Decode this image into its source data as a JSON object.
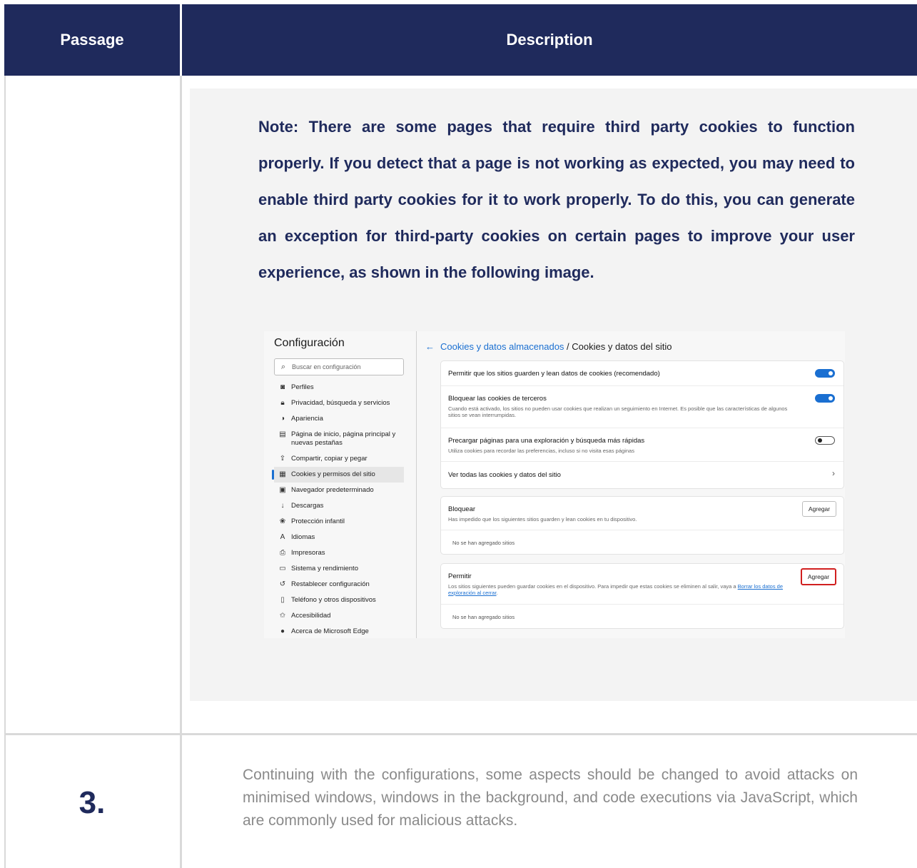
{
  "table": {
    "headers": {
      "passage": "Passage",
      "description": "Description"
    }
  },
  "note": {
    "text": "Note: There are some pages that require third party cookies to function properly. If you detect that a page is not working as expected, you may need to enable third party cookies for it to work properly. To do this, you can generate an exception for third-party cookies on certain pages to improve your user experience, as shown in the following image."
  },
  "settings": {
    "title": "Configuración",
    "search_placeholder": "Buscar en configuración",
    "nav": [
      {
        "icon": "profile-icon",
        "glyph": "◙",
        "label": "Perfiles"
      },
      {
        "icon": "lock-icon",
        "glyph": "🔒︎",
        "label": "Privacidad, búsqueda y servicios"
      },
      {
        "icon": "appearance-icon",
        "glyph": "◑",
        "label": "Apariencia"
      },
      {
        "icon": "homepage-icon",
        "glyph": "▤",
        "label": "Página de inicio, página principal y nuevas pestañas"
      },
      {
        "icon": "share-icon",
        "glyph": "⇪",
        "label": "Compartir, copiar y pegar"
      },
      {
        "icon": "cookies-icon",
        "glyph": "▦",
        "label": "Cookies y permisos del sitio",
        "active": true
      },
      {
        "icon": "browser-icon",
        "glyph": "▣",
        "label": "Navegador predeterminado"
      },
      {
        "icon": "download-icon",
        "glyph": "↓",
        "label": "Descargas"
      },
      {
        "icon": "family-icon",
        "glyph": "❀",
        "label": "Protección infantil"
      },
      {
        "icon": "language-icon",
        "glyph": "A",
        "label": "Idiomas"
      },
      {
        "icon": "printer-icon",
        "glyph": "⎙",
        "label": "Impresoras"
      },
      {
        "icon": "system-icon",
        "glyph": "▭",
        "label": "Sistema y rendimiento"
      },
      {
        "icon": "reset-icon",
        "glyph": "↺",
        "label": "Restablecer configuración"
      },
      {
        "icon": "phone-icon",
        "glyph": "▯",
        "label": "Teléfono y otros dispositivos"
      },
      {
        "icon": "accessibility-icon",
        "glyph": "✩",
        "label": "Accesibilidad"
      },
      {
        "icon": "edge-icon",
        "glyph": "●",
        "label": "Acerca de Microsoft Edge"
      }
    ],
    "breadcrumb": {
      "back": "←",
      "parent": "Cookies y datos almacenados",
      "separator": " / ",
      "current": "Cookies y datos del sitio"
    },
    "options": {
      "allow_cookies": {
        "title": "Permitir que los sitios guarden y lean datos de cookies (recomendado)",
        "on": true
      },
      "block_third_party": {
        "title": "Bloquear las cookies de terceros",
        "sub": "Cuando está activado, los sitios no pueden usar cookies que realizan un seguimiento en Internet. Es posible que las características de algunos sitios se vean interrumpidas.",
        "on": true
      },
      "preload": {
        "title": "Precargar páginas para una exploración y búsqueda más rápidas",
        "sub": "Utiliza cookies para recordar las preferencias, incluso si no visita esas páginas",
        "on": false
      },
      "see_all": {
        "title": "Ver todas las cookies y datos del sitio",
        "chevron": "›"
      }
    },
    "block": {
      "title": "Bloquear",
      "sub": "Has impedido que los siguientes sitios guarden y lean cookies en tu dispositivo.",
      "button": "Agregar",
      "empty": "No se han agregado sitios"
    },
    "allow": {
      "title": "Permitir",
      "sub": "Los sitios siguientes pueden guardar cookies en el dispositivo. Para impedir que estas cookies se eliminen al salir, vaya a ",
      "link": "Borrar los datos de exploración al cerrar",
      "sub_end": ".",
      "button": "Agregar",
      "empty": "No se han agregado sitios"
    }
  },
  "step": {
    "number": "3.",
    "text": "Continuing with the configurations, some aspects should be changed to avoid attacks on minimised windows, windows in the background, and code executions via JavaScript, which are commonly used for malicious attacks."
  }
}
